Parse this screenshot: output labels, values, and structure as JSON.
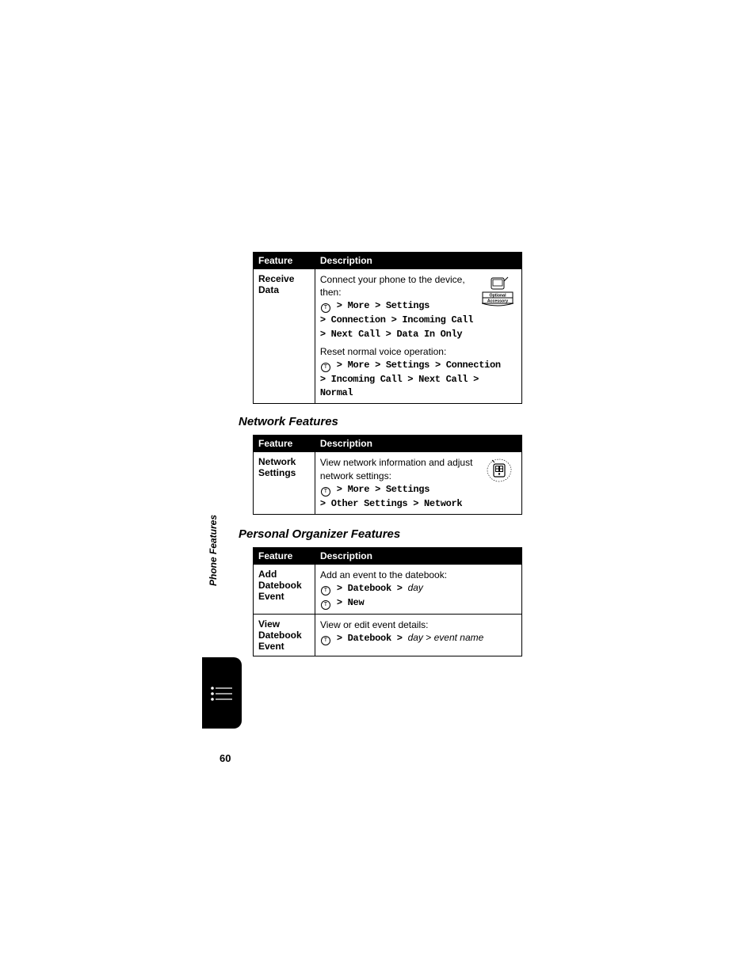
{
  "sideLabel": "Phone Features",
  "pageNumber": "60",
  "tables": {
    "t1": {
      "hFeature": "Feature",
      "hDesc": "Description",
      "r1_feature": "Receive Data",
      "r1_line1": "Connect your phone to the device, then:",
      "r1_path1a": " > More > Settings",
      "r1_path1b": "> Connection > Incoming Call",
      "r1_path1c": "> Next Call > Data In Only",
      "r1_line2": "Reset normal voice operation:",
      "r1_path2a": " > More > Settings > Connection",
      "r1_path2b": "> Incoming Call > Next Call > Normal",
      "badge1_top": "Optional",
      "badge1_bot": "Accessory"
    },
    "t2": {
      "heading": "Network Features",
      "hFeature": "Feature",
      "hDesc": "Description",
      "r1_feature": "Network Settings",
      "r1_line1": "View network information and adjust network settings:",
      "r1_path1a": " > More > Settings",
      "r1_path1b": "> Other Settings > Network"
    },
    "t3": {
      "heading": "Personal Organizer Features",
      "hFeature": "Feature",
      "hDesc": "Description",
      "r1_feature": "Add Datebook Event",
      "r1_line1": "Add an event to the datebook:",
      "r1_path1a_pre": " > Datebook > ",
      "r1_path1a_it": "day",
      "r1_path1b": " > New",
      "r2_feature": "View Datebook Event",
      "r2_line1": "View or edit event details:",
      "r2_path1a_pre": " > Datebook > ",
      "r2_path1a_it1": "day",
      "r2_path1a_mid": " > ",
      "r2_path1a_it2": "event name"
    }
  }
}
